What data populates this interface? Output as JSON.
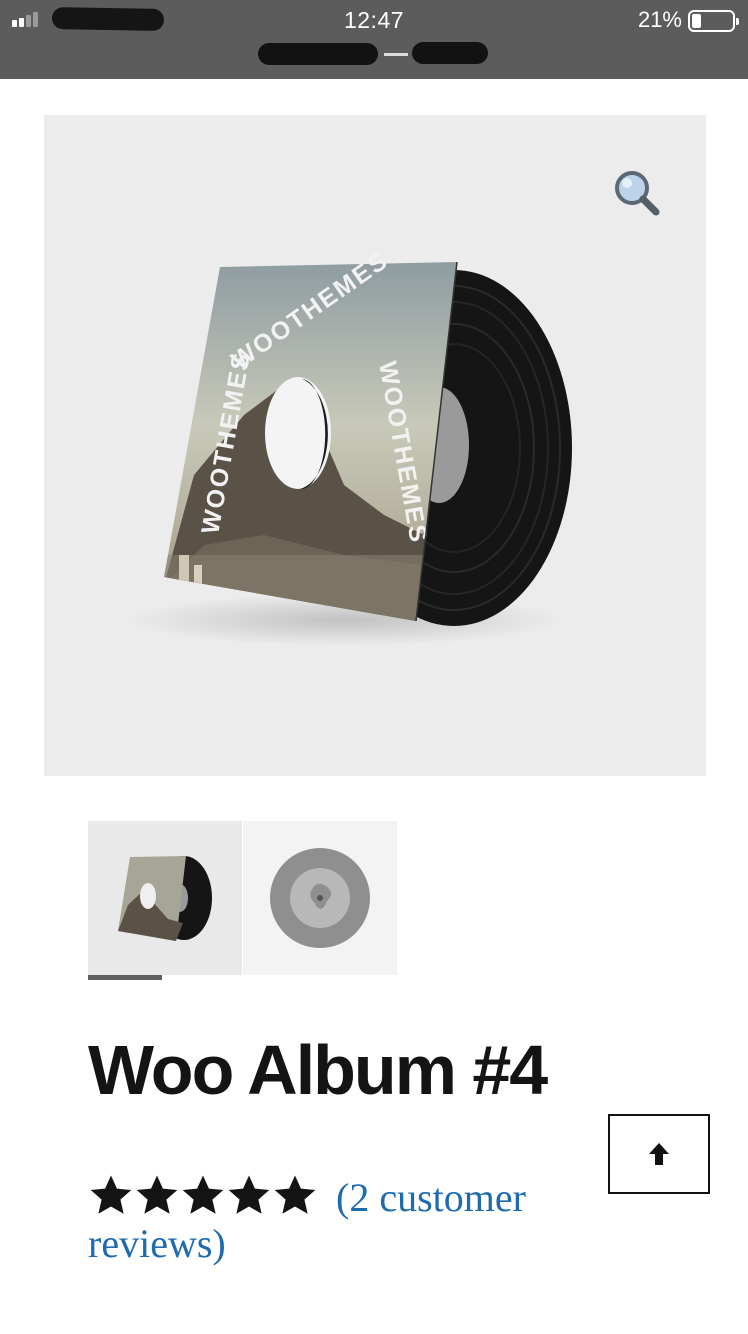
{
  "status_bar": {
    "time": "12:47",
    "battery_percent": "21%",
    "battery_level": 0.21
  },
  "product": {
    "title": "Woo Album #4",
    "image_alt": "Vinyl record with album sleeve",
    "sleeve_text": "WOOTHEMES",
    "rating": 5,
    "reviews_link_line1": "(2 customer",
    "reviews_link_line2": "reviews)",
    "thumbnails": [
      {
        "name": "album-sleeve-thumb",
        "active": true
      },
      {
        "name": "vinyl-label-thumb",
        "active": false
      }
    ]
  },
  "icons": {
    "zoom": "magnifier-icon",
    "back_to_top": "arrow-up-icon",
    "star": "star-icon"
  },
  "colors": {
    "status_bar_bg": "#5c5c5c",
    "image_bg": "#ececec",
    "title": "#141414",
    "link": "#1f6bb0"
  }
}
